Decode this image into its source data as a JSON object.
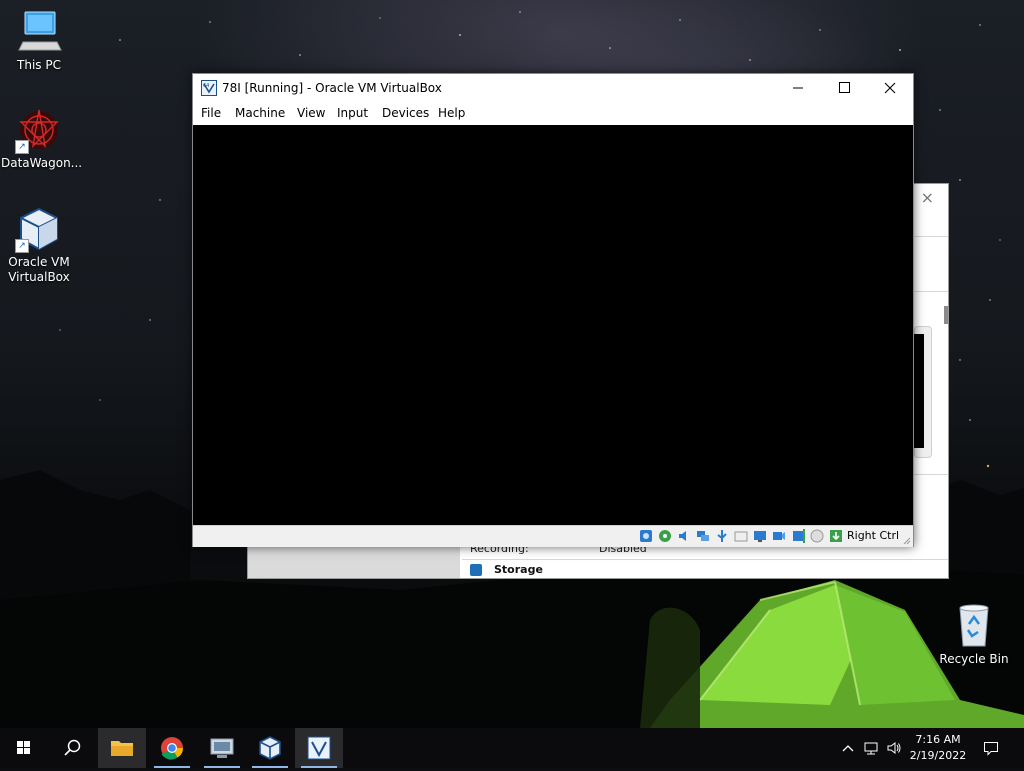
{
  "desktop": {
    "icons": [
      {
        "label": "This PC"
      },
      {
        "label": "DataWagon..."
      },
      {
        "label": "Oracle VM VirtualBox"
      },
      {
        "label": "Recycle Bin"
      }
    ]
  },
  "manager_window": {
    "recording_label": "Recording:",
    "recording_value": "Disabled",
    "storage_label": "Storage",
    "close_glyph": "×"
  },
  "vm_window": {
    "title": "78I [Running] - Oracle VM VirtualBox",
    "menu": [
      "File",
      "Machine",
      "View",
      "Input",
      "Devices",
      "Help"
    ],
    "host_key": "Right Ctrl",
    "status_icons": [
      "hard-disk-icon",
      "optical-disk-icon",
      "audio-icon",
      "network-icon",
      "usb-icon",
      "shared-folders-icon",
      "display-icon",
      "video-capture-icon",
      "cpu-icon",
      "mouse-integration-icon",
      "keyboard-icon"
    ]
  },
  "taskbar": {
    "apps": [
      "start-icon",
      "search-icon",
      "file-explorer-icon",
      "chrome-icon",
      "remote-desktop-icon",
      "virtualbox-icon",
      "virtualbox-vm-icon"
    ],
    "clock_time": "7:16 AM",
    "clock_date": "2/19/2022"
  },
  "colors": {
    "accent": "#1f6fb8",
    "tent_green": "#7dd33a",
    "taskbar": "#0b0b0d"
  }
}
